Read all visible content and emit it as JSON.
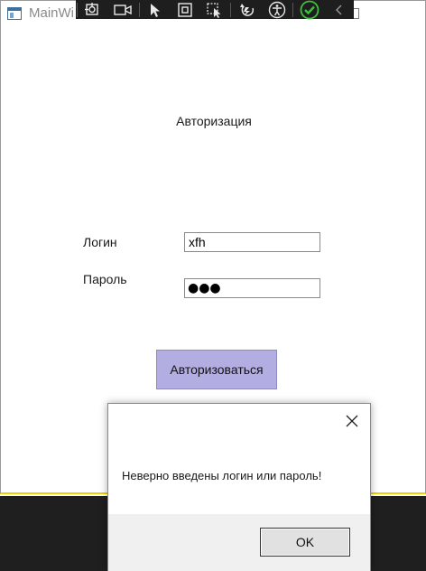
{
  "window": {
    "title": "MainWi"
  },
  "debug_toolbar": {
    "icons": [
      "select-element-icon",
      "video-capture-icon",
      "select-pointer-icon",
      "layout-adorner-icon",
      "track-focus-icon",
      "hot-reload-icon",
      "accessibility-icon",
      "checkmark-icon",
      "collapse-chevron-icon"
    ]
  },
  "auth_form": {
    "title": "Авторизация",
    "login_label": "Логин",
    "login_value": "xfh",
    "password_label": "Пароль",
    "password_mask": "●●●",
    "submit_label": "Авторизоваться",
    "submit_color": "#b3aee2"
  },
  "message_box": {
    "text": "Неверно введены логин или пароль!",
    "ok_label": "OK"
  }
}
